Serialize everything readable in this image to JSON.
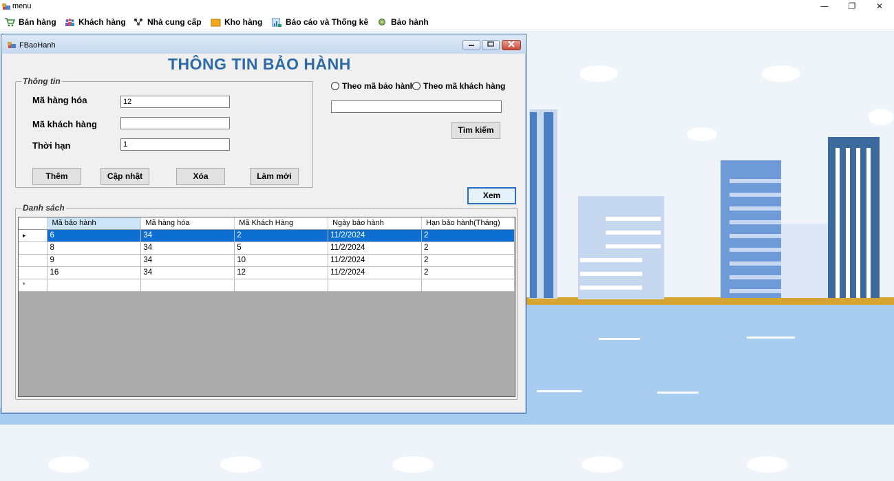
{
  "window": {
    "title": "menu",
    "minimize": "—",
    "restore": "❐",
    "close": "✕"
  },
  "menubar": {
    "items": [
      {
        "label": "Bán hàng",
        "icon": "cart-icon"
      },
      {
        "label": "Khách hàng",
        "icon": "customers-icon"
      },
      {
        "label": "Nhà cung cấp",
        "icon": "suppliers-icon"
      },
      {
        "label": "Kho hàng",
        "icon": "warehouse-icon"
      },
      {
        "label": "Báo cáo và Thống kê",
        "icon": "report-icon"
      },
      {
        "label": "Bảo hành",
        "icon": "warranty-icon"
      }
    ]
  },
  "form": {
    "title": "FBaoHanh",
    "heading": "THÔNG TIN BẢO HÀNH",
    "info_group": {
      "legend": "Thông tin",
      "product_label": "Mã hàng hóa",
      "product_value": "12",
      "customer_label": "Mã khách hàng",
      "customer_value": "",
      "term_label": "Thời hạn",
      "term_value": "1",
      "add_button": "Thêm",
      "update_button": "Cập nhật",
      "delete_button": "Xóa",
      "refresh_button": "Làm mới"
    },
    "search": {
      "radio_warranty": "Theo mã bảo hành",
      "radio_customer": "Theo mã khách hàng",
      "query": "",
      "search_button": "Tìm kiếm"
    },
    "view_button": "Xem",
    "list_group": {
      "legend": "Danh sách"
    },
    "grid": {
      "columns": [
        "Mã bảo hành",
        "Mã hàng hóa",
        "Mã Khách Hàng",
        "Ngày bảo hành",
        "Hạn bảo hành(Tháng)"
      ],
      "rows": [
        [
          "6",
          "34",
          "2",
          "11/2/2024",
          "2"
        ],
        [
          "8",
          "34",
          "5",
          "11/2/2024",
          "2"
        ],
        [
          "9",
          "34",
          "10",
          "11/2/2024",
          "2"
        ],
        [
          "16",
          "34",
          "12",
          "11/2/2024",
          "2"
        ]
      ],
      "selected_row": 0,
      "current_row_marker": "▸",
      "new_row_marker": "*"
    }
  }
}
